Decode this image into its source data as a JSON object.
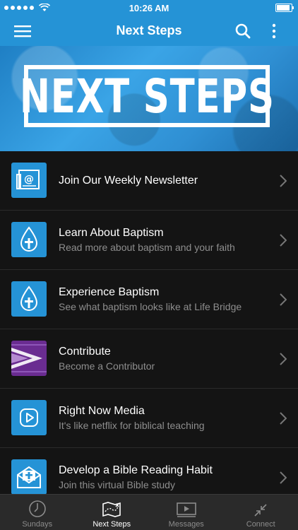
{
  "status": {
    "time": "10:26 AM",
    "signal_dots": 5
  },
  "nav": {
    "title": "Next Steps"
  },
  "hero": {
    "text": "NEXT STEPS"
  },
  "list": [
    {
      "title": "Join Our Weekly Newsletter",
      "subtitle": "",
      "icon": "newsletter-icon",
      "color": "#2593d6"
    },
    {
      "title": "Learn About Baptism",
      "subtitle": "Read more about baptism and your faith",
      "icon": "water-cross-icon",
      "color": "#2593d6"
    },
    {
      "title": "Experience Baptism",
      "subtitle": "See what baptism looks like at Life Bridge",
      "icon": "water-cross-icon",
      "color": "#2593d6"
    },
    {
      "title": "Contribute",
      "subtitle": "Become a Contributor",
      "icon": "contribute-logo-icon",
      "color": "#6a2c91"
    },
    {
      "title": "Right Now Media",
      "subtitle": "It's like netflix for biblical teaching",
      "icon": "play-icon",
      "color": "#2593d6"
    },
    {
      "title": "Develop a Bible Reading Habit",
      "subtitle": "Join this virtual Bible study",
      "icon": "bible-envelope-icon",
      "color": "#2593d6"
    }
  ],
  "tabs": [
    {
      "label": "Sundays",
      "icon": "clock-icon",
      "active": false
    },
    {
      "label": "Next Steps",
      "icon": "map-icon",
      "active": true
    },
    {
      "label": "Messages",
      "icon": "video-icon",
      "active": false
    },
    {
      "label": "Connect",
      "icon": "connect-icon",
      "active": false
    }
  ],
  "colors": {
    "accent": "#2593d6",
    "background": "#141414",
    "tabbar": "#2a2a2a"
  }
}
